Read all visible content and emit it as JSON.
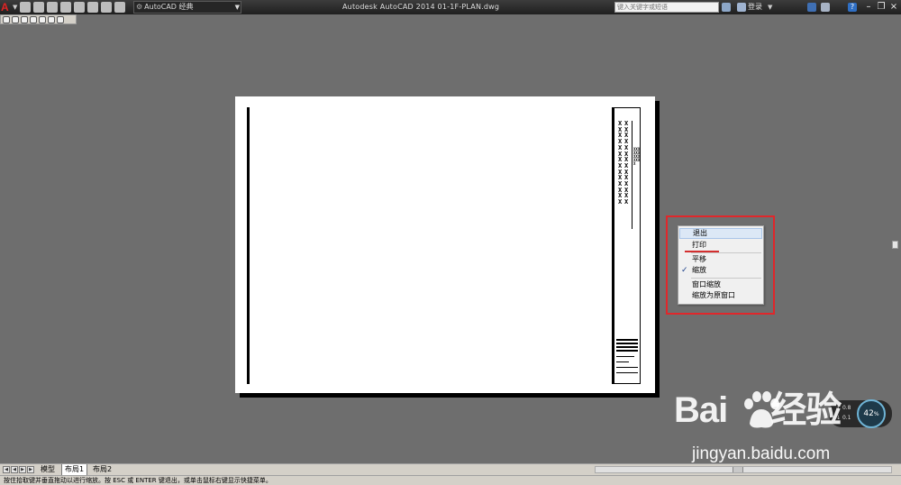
{
  "titlebar": {
    "app_logo": "A",
    "workspace": "AutoCAD 经典",
    "window_title": "Autodesk AutoCAD 2014    01-1F-PLAN.dwg",
    "search_placeholder": "键入关键字或短语",
    "signin_label": "登录",
    "help_label": "?"
  },
  "context_menu": {
    "items": [
      "退出",
      "打印",
      "平移",
      "缩放",
      "窗口缩放",
      "缩放为原窗口"
    ],
    "checked_item": "缩放"
  },
  "performance": {
    "line1": "0.8",
    "line2": "0.1",
    "percent": "42",
    "percent_unit": "%"
  },
  "watermark": {
    "brand": "Bai",
    "brand2": "经验",
    "url": "jingyan.baidu.com"
  },
  "layout_tabs": [
    "模型",
    "布局1",
    "布局2"
  ],
  "status_text": "按住拾取键并垂直拖动以进行缩放。按 ESC 或 ENTER 键退出，或单击鼠标右键显示快捷菜单。",
  "colors": {
    "highlight_red": "#e0272b",
    "canvas_gray": "#6e6e6e"
  }
}
